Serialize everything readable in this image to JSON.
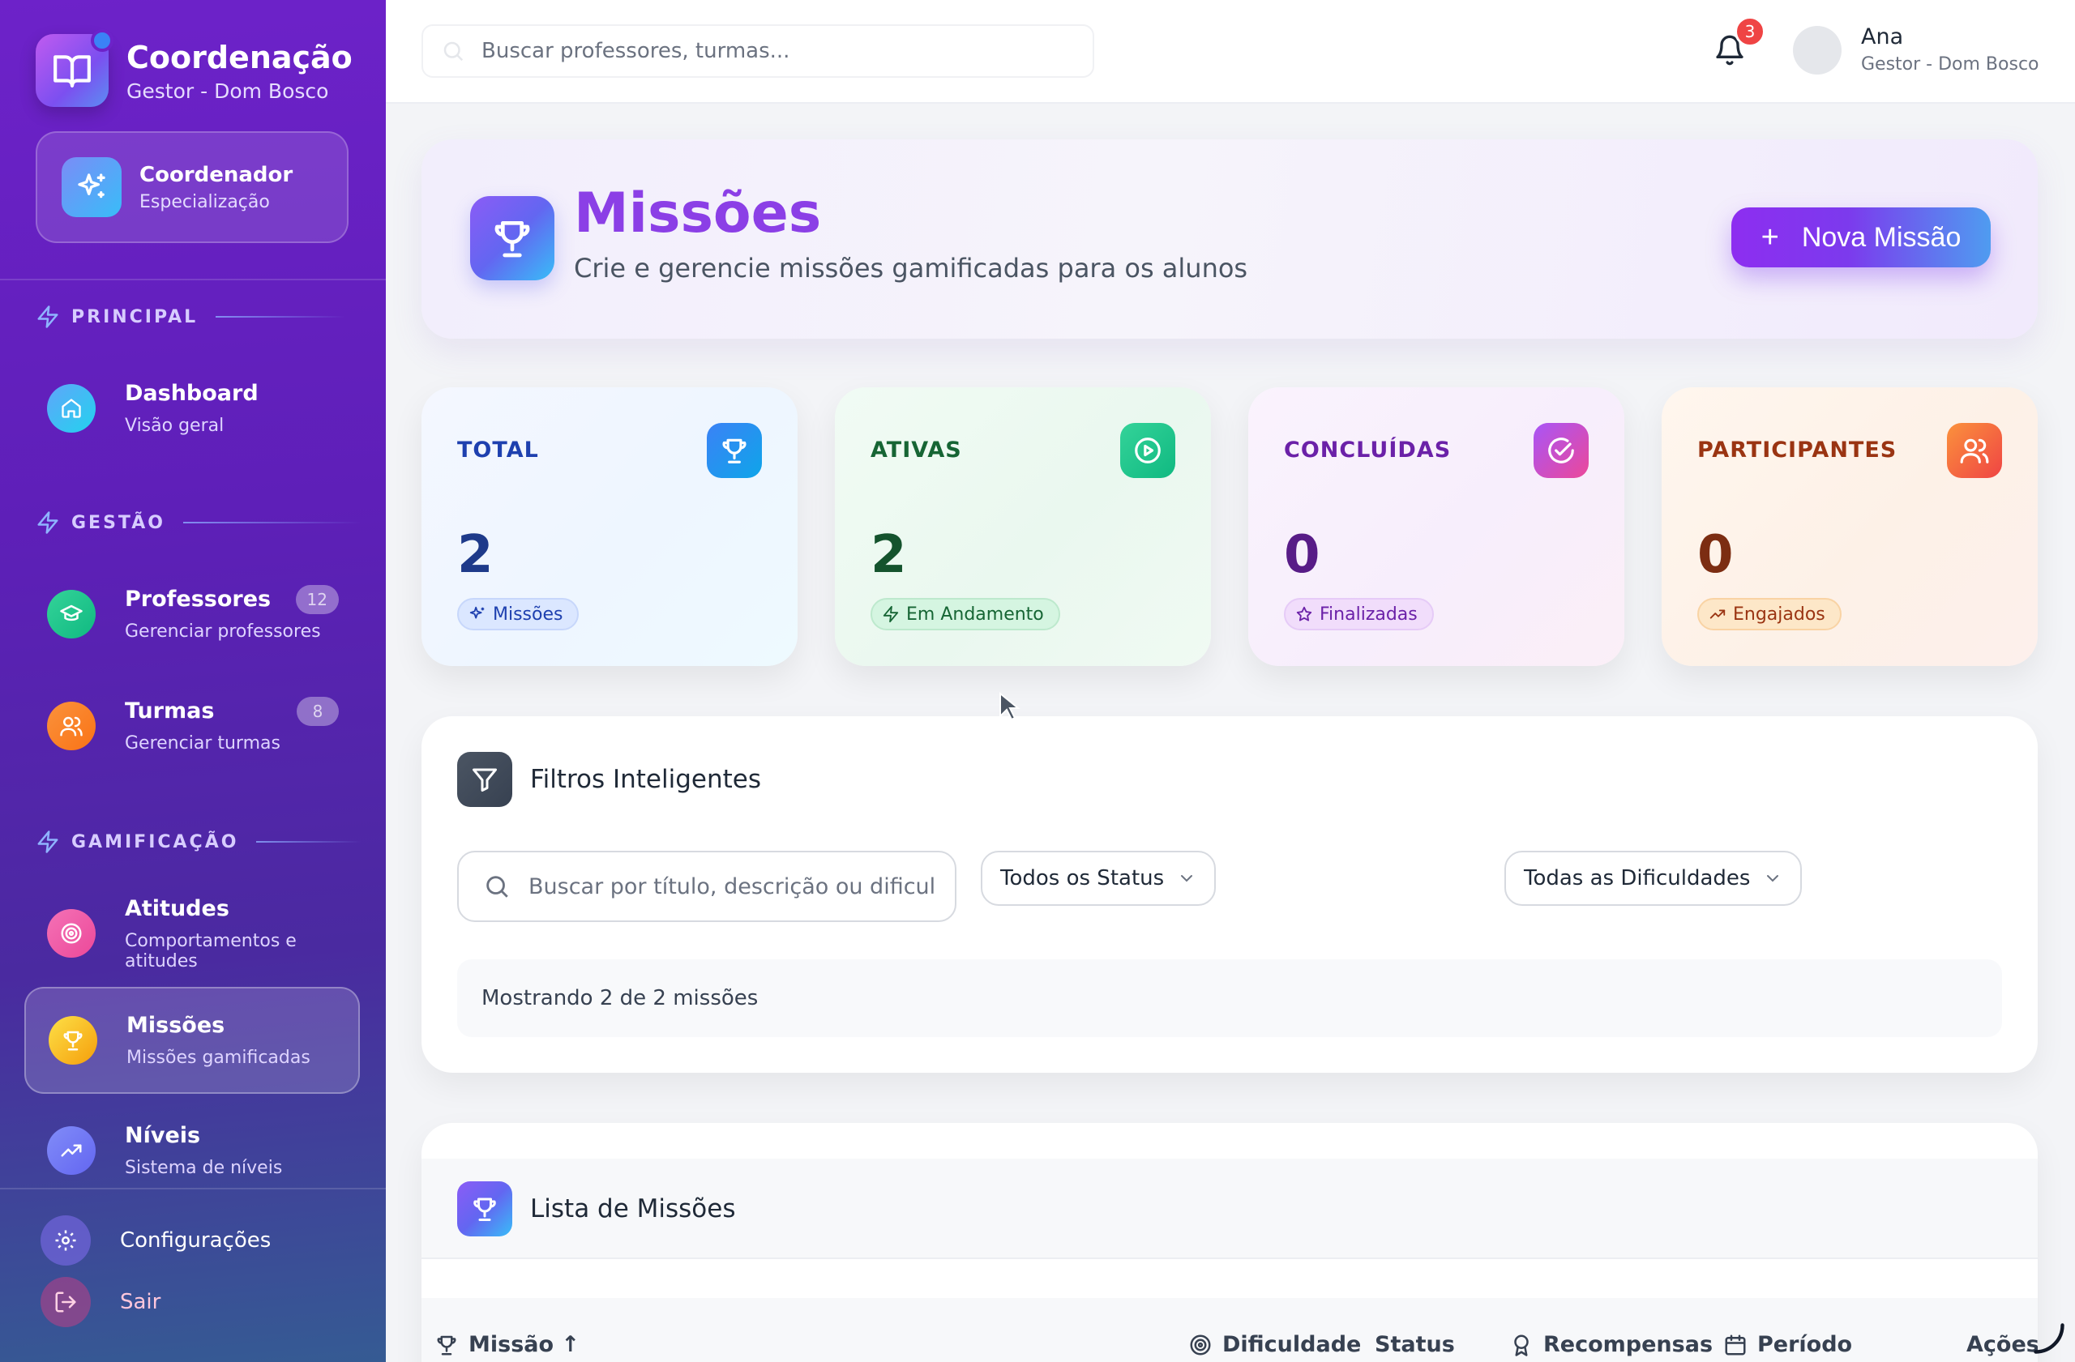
{
  "sidebar": {
    "brand": {
      "title": "Coordenação",
      "subtitle": "Gestor - Dom Bosco"
    },
    "role": {
      "title": "Coordenador",
      "subtitle": "Especialização"
    },
    "sections": {
      "principal": "PRINCIPAL",
      "gestao": "GESTÃO",
      "gamificacao": "GAMIFICAÇÃO"
    },
    "items": [
      {
        "title": "Dashboard",
        "subtitle": "Visão geral"
      },
      {
        "title": "Professores",
        "subtitle": "Gerenciar professores",
        "badge": "12"
      },
      {
        "title": "Turmas",
        "subtitle": "Gerenciar turmas",
        "badge": "8"
      },
      {
        "title": "Atitudes",
        "subtitle": "Comportamentos e atitudes"
      },
      {
        "title": "Missões",
        "subtitle": "Missões gamificadas"
      },
      {
        "title": "Níveis",
        "subtitle": "Sistema de níveis"
      }
    ],
    "settings_label": "Configurações",
    "logout_label": "Sair"
  },
  "header": {
    "search_placeholder": "Buscar professores, turmas...",
    "notifications_count": "3",
    "user_name": "Ana",
    "user_role": "Gestor - Dom Bosco"
  },
  "hero": {
    "title": "Missões",
    "subtitle": "Crie e gerencie missões gamificadas para os alunos",
    "new_button_label": "Nova Missão"
  },
  "stats": [
    {
      "label": "TOTAL",
      "value": "2",
      "pill": "Missões",
      "color": "#1e3a8a"
    },
    {
      "label": "ATIVAS",
      "value": "2",
      "pill": "Em Andamento",
      "color": "#14532d"
    },
    {
      "label": "CONCLUÍDAS",
      "value": "0",
      "pill": "Finalizadas",
      "color": "#581c87"
    },
    {
      "label": "PARTICIPANTES",
      "value": "0",
      "pill": "Engajados",
      "color": "#7c2d12"
    }
  ],
  "filters": {
    "title": "Filtros Inteligentes",
    "search_placeholder": "Buscar por título, descrição ou dificuldade...",
    "status_select": "Todos os Status",
    "difficulty_select": "Todas as Dificuldades",
    "showing_text": "Mostrando 2 de 2 missões"
  },
  "list": {
    "title": "Lista de Missões",
    "columns": {
      "mission": "Missão ↑",
      "difficulty": "Dificuldade",
      "status": "Status",
      "rewards": "Recompensas",
      "period": "Período",
      "actions": "Ações"
    }
  }
}
